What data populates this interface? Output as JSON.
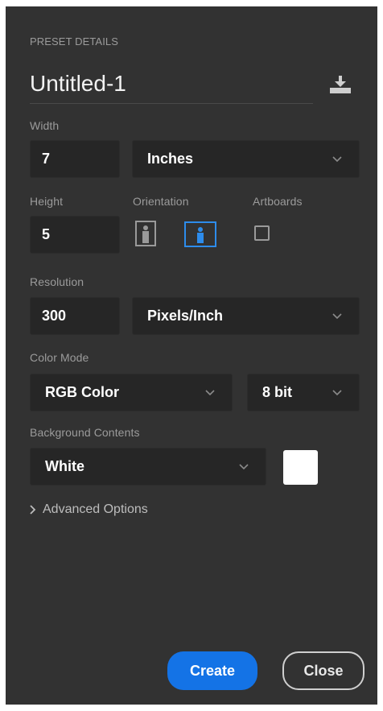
{
  "preset": {
    "section_label": "PRESET DETAILS",
    "name": "Untitled-1"
  },
  "width": {
    "label": "Width",
    "value": "7",
    "unit": "Inches"
  },
  "height": {
    "label": "Height",
    "value": "5"
  },
  "orientation": {
    "label": "Orientation",
    "selected": "landscape"
  },
  "artboards": {
    "label": "Artboards",
    "checked": false
  },
  "resolution": {
    "label": "Resolution",
    "value": "300",
    "unit": "Pixels/Inch"
  },
  "color_mode": {
    "label": "Color Mode",
    "mode": "RGB Color",
    "depth": "8 bit"
  },
  "background": {
    "label": "Background Contents",
    "value": "White",
    "swatch_color": "#ffffff"
  },
  "advanced": {
    "label": "Advanced Options"
  },
  "buttons": {
    "create": "Create",
    "close": "Close"
  },
  "colors": {
    "panel_bg": "#323232",
    "field_bg": "#262626",
    "accent": "#1473e6"
  }
}
